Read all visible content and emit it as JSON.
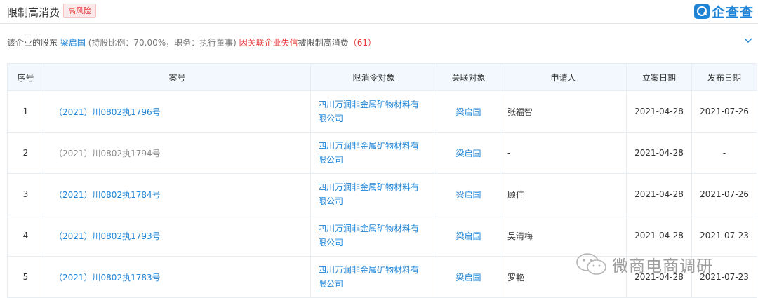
{
  "header": {
    "title": "限制高消费",
    "risk_tag": "高风险",
    "logo_text": "企查查"
  },
  "summary": {
    "prefix": "该企业的股东",
    "shareholder": "梁启国",
    "detail": "(持股比例：70.00%，职务：执行董事)",
    "reason": "因关联企业失信",
    "suffix": "被限制高消费",
    "count_open": "（",
    "count": "61",
    "count_close": "）"
  },
  "table": {
    "columns": [
      "序号",
      "案号",
      "限消令对象",
      "关联对象",
      "申请人",
      "立案日期",
      "发布日期"
    ],
    "rows": [
      {
        "idx": "1",
        "case": "（2021）川0802执1796号",
        "target_line1": "四川万润非金属矿物材料有",
        "target_line2": "限公司",
        "related": "梁启国",
        "applicant": "张福智",
        "filed": "2021-04-28",
        "published": "2021-07-26",
        "case_link": true
      },
      {
        "idx": "2",
        "case": "（2021）川0802执1794号",
        "target_line1": "四川万润非金属矿物材料有",
        "target_line2": "限公司",
        "related": "梁启国",
        "applicant": "-",
        "filed": "2021-04-28",
        "published": "-",
        "case_link": false
      },
      {
        "idx": "3",
        "case": "（2021）川0802执1784号",
        "target_line1": "四川万润非金属矿物材料有",
        "target_line2": "限公司",
        "related": "梁启国",
        "applicant": "顾佳",
        "filed": "2021-04-28",
        "published": "2021-07-26",
        "case_link": true
      },
      {
        "idx": "4",
        "case": "（2021）川0802执1793号",
        "target_line1": "四川万润非金属矿物材料有",
        "target_line2": "限公司",
        "related": "梁启国",
        "applicant": "吴清梅",
        "filed": "2021-04-28",
        "published": "2021-07-23",
        "case_link": true
      },
      {
        "idx": "5",
        "case": "（2021）川0802执1783号",
        "target_line1": "四川万润非金属矿物材料有",
        "target_line2": "限公司",
        "related": "梁启国",
        "applicant": "罗艳",
        "filed": "2021-04-28",
        "published": "2021-07-23",
        "case_link": true
      }
    ]
  },
  "watermark": {
    "text": "微商电商调研",
    "icon": "wechat-icon"
  },
  "colors": {
    "link": "#1f84d6",
    "danger": "#e4393c",
    "header_bg": "#f2f8fd"
  }
}
